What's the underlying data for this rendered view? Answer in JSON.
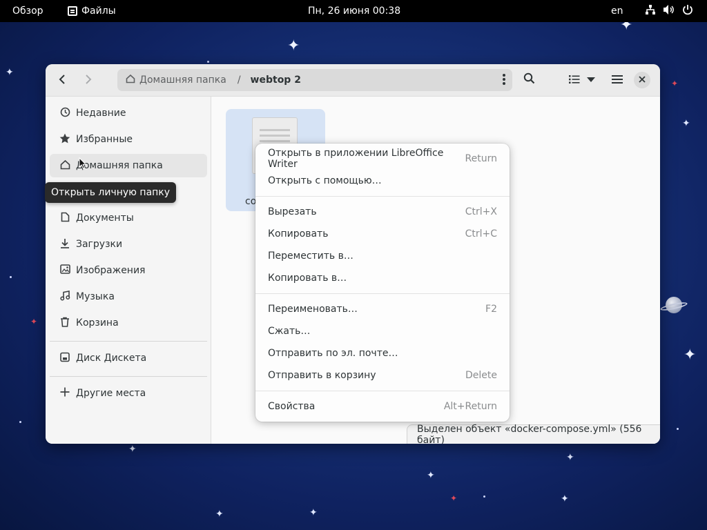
{
  "topbar": {
    "overview": "Обзор",
    "app_name": "Файлы",
    "clock": "Пн, 26 июня  00:38",
    "lang": "en"
  },
  "path_bar": {
    "home": "Домашняя папка",
    "separator": "/",
    "current": "webtop 2"
  },
  "sidebar": {
    "items": [
      {
        "label": "Недавние",
        "icon": "clock-icon"
      },
      {
        "label": "Избранные",
        "icon": "star-icon"
      },
      {
        "label": "Домашняя папка",
        "icon": "home-icon"
      },
      {
        "label": "Документы",
        "icon": "document-icon"
      },
      {
        "label": "Загрузки",
        "icon": "download-icon"
      },
      {
        "label": "Изображения",
        "icon": "image-icon"
      },
      {
        "label": "Музыка",
        "icon": "music-icon"
      },
      {
        "label": "Корзина",
        "icon": "trash-icon"
      }
    ],
    "drive": "Диск Дискета",
    "other": "Другие места"
  },
  "tooltip": "Открыть личную папку",
  "file": {
    "label_visible": "co"
  },
  "context_menu": {
    "items": [
      {
        "label": "Открыть в приложении LibreOffice Writer",
        "accel": "Return"
      },
      {
        "label": "Открыть с помощью…",
        "accel": ""
      },
      {
        "label": "Вырезать",
        "accel": "Ctrl+X"
      },
      {
        "label": "Копировать",
        "accel": "Ctrl+C"
      },
      {
        "label": "Переместить в…",
        "accel": ""
      },
      {
        "label": "Копировать в…",
        "accel": ""
      },
      {
        "label": "Переименовать…",
        "accel": "F2"
      },
      {
        "label": "Сжать…",
        "accel": ""
      },
      {
        "label": "Отправить по эл. почте…",
        "accel": ""
      },
      {
        "label": "Отправить в корзину",
        "accel": "Delete"
      },
      {
        "label": "Свойства",
        "accel": "Alt+Return"
      }
    ]
  },
  "status": "Выделен объект «docker-compose.yml»  (556 байт)",
  "colors": {
    "accent_selection": "#d6e3f5",
    "topbar": "#000000",
    "desktop": "#173278"
  }
}
